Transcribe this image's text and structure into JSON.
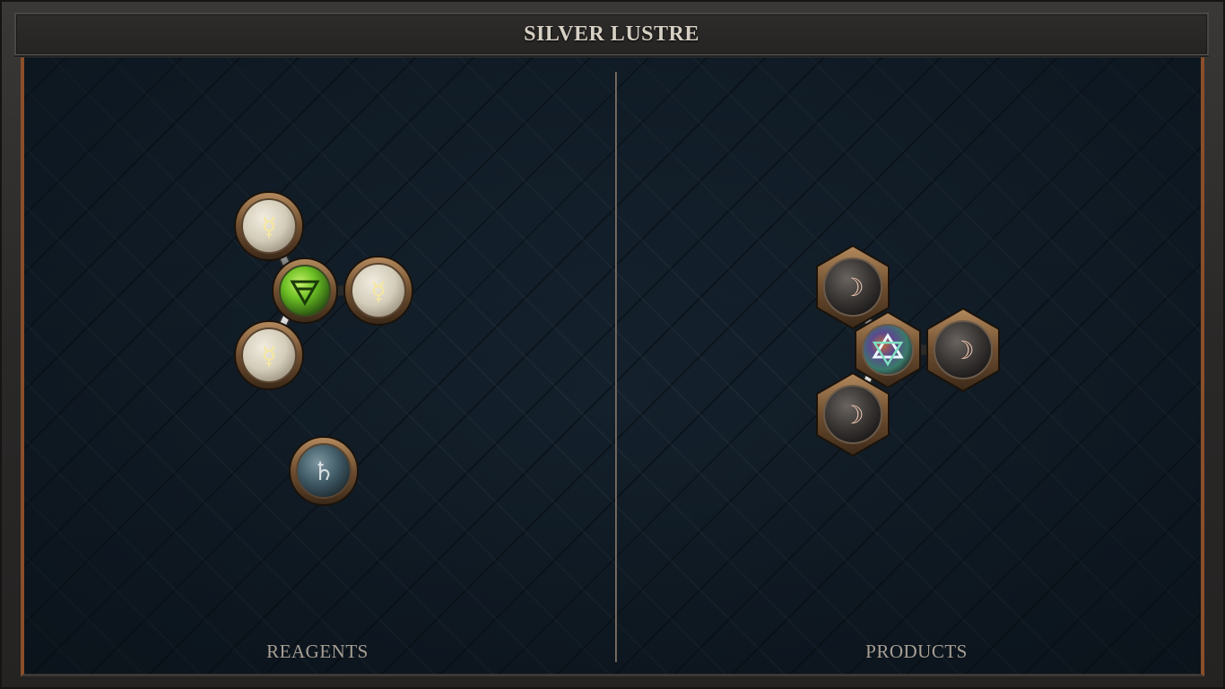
{
  "header": {
    "title": "SILVER LUSTRE"
  },
  "panels": {
    "reagents": {
      "label": "REAGENTS",
      "molecules": [
        {
          "atoms": [
            {
              "element": "mercury",
              "glyph": "☿",
              "color": "#d8d2bf"
            },
            {
              "element": "mercury",
              "glyph": "☿",
              "color": "#d8d2bf"
            },
            {
              "element": "mercury",
              "glyph": "☿",
              "color": "#d8d2bf"
            },
            {
              "element": "earth",
              "glyph": "🜃",
              "color": "#6cc024"
            }
          ]
        },
        {
          "atoms": [
            {
              "element": "lead",
              "glyph": "♄",
              "color": "#3f5965"
            }
          ]
        }
      ]
    },
    "products": {
      "label": "PRODUCTS",
      "molecules": [
        {
          "atoms": [
            {
              "element": "silver",
              "glyph": "☽",
              "color": "#3a3735"
            },
            {
              "element": "silver",
              "glyph": "☽",
              "color": "#3a3735"
            },
            {
              "element": "silver",
              "glyph": "☽",
              "color": "#3a3735"
            },
            {
              "element": "quintessence",
              "glyph": "✡",
              "color": "#5a4a5e"
            }
          ]
        }
      ]
    }
  }
}
